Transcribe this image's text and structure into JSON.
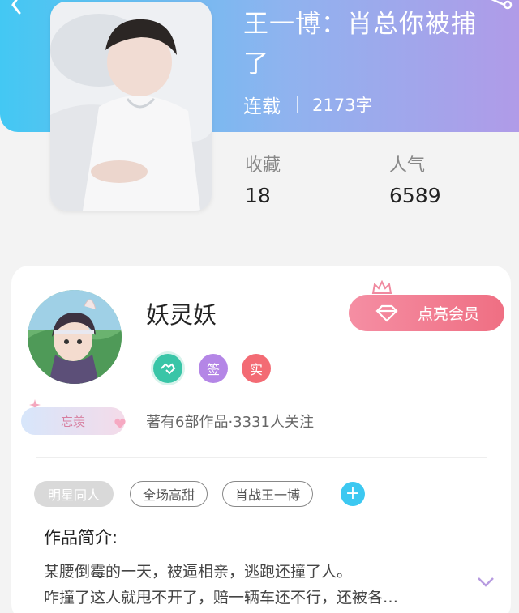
{
  "book": {
    "title": "王一博：肖总你被捕了",
    "status": "连载",
    "word_count": "2173字",
    "stats": {
      "favorites_label": "收藏",
      "favorites_value": "18",
      "popularity_label": "人气",
      "popularity_value": "6589"
    }
  },
  "author": {
    "name": "妖灵妖",
    "badges": {
      "verify_icon": "handshake-icon",
      "sign": "签",
      "real": "实"
    },
    "fan_tag": "忘羡",
    "stats_text": "著有6部作品·3331人关注"
  },
  "vip_button": {
    "label": "点亮会员"
  },
  "tags": [
    "明星同人",
    "全场高甜",
    "肖战王一博"
  ],
  "intro": {
    "title": "作品简介:",
    "line1": "某腰倒霉的一天，被逼相亲，逃跑还撞了人。",
    "line2": "咋撞了这人就甩不开了，赔一辆车还不行，还被各…"
  },
  "colors": {
    "header_start": "#43c8f3",
    "header_end": "#b09be8",
    "vip": "#ef6f83",
    "accent_blue": "#3cc8f1",
    "badge_green": "#39c5a7",
    "badge_purple": "#b486e6",
    "badge_red": "#f36b74"
  },
  "icons": [
    "back-icon",
    "share-icon",
    "crown-icon",
    "gem-icon",
    "heart-icon",
    "plus-icon",
    "chevron-down-icon"
  ]
}
